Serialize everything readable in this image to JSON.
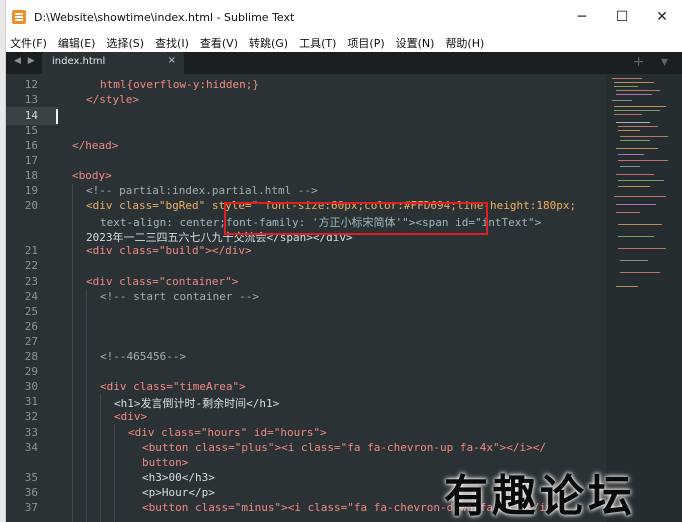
{
  "window": {
    "title": "D:\\Website\\showtime\\index.html - Sublime Text",
    "controls": {
      "minimize": "─",
      "maximize": "☐",
      "close": "✕"
    }
  },
  "menu": {
    "items": [
      "文件(F)",
      "编辑(E)",
      "选择(S)",
      "查找(I)",
      "查看(V)",
      "转跳(G)",
      "工具(T)",
      "项目(P)",
      "设置(N)",
      "帮助(H)"
    ]
  },
  "tabs": {
    "nav": "◀ ▶",
    "active": {
      "label": "index.html",
      "close": "×"
    },
    "actions": "+ ▾"
  },
  "editor": {
    "line_numbers": [
      "12",
      "13",
      "14",
      "15",
      "16",
      "17",
      "18",
      "19",
      "20",
      "",
      "",
      "21",
      "22",
      "23",
      "24",
      "25",
      "26",
      "27",
      "28",
      "29",
      "30",
      "31",
      "32",
      "33",
      "34",
      "",
      "35",
      "36",
      "37"
    ],
    "current_line": "14",
    "lines": {
      "l12": "html{overflow-y:hidden;}",
      "l13": "</style>",
      "l16": "</head>",
      "l18": "<body>",
      "l19": "<!-- partial:index.partial.html -->",
      "l20a": "<div class=\"bgRed\" style=\" font-size:60px;color:#FFD694;line-height:180px;",
      "l20b": "text-align: center;font-family: '方正小标宋简体'\"><span id=\"intText\">",
      "l20c": "2023年一二三四五六七八九十交流会</span></div>",
      "l21": "<div class=\"build\"></div>",
      "l23": "<div class=\"container\">",
      "l24": "<!-- start container -->",
      "l28": "<!--465456-->",
      "l30": "<div class=\"timeArea\">",
      "l31": "<h1>发言倒计时-剩余时间</h1>",
      "l32": "<div>",
      "l33": "<div class=\"hours\" id=\"hours\">",
      "l34a": "<button class=\"plus\"><i class=\"fa fa-chevron-up fa-4x\"></i></",
      "l34b": "button>",
      "l35": "<h3>00</h3>",
      "l36": "<p>Hour</p>",
      "l37": "<button class=\"minus\"><i class=\"fa fa-chevron-down fa-4x\"></i></"
    }
  },
  "watermark": "有趣论坛"
}
